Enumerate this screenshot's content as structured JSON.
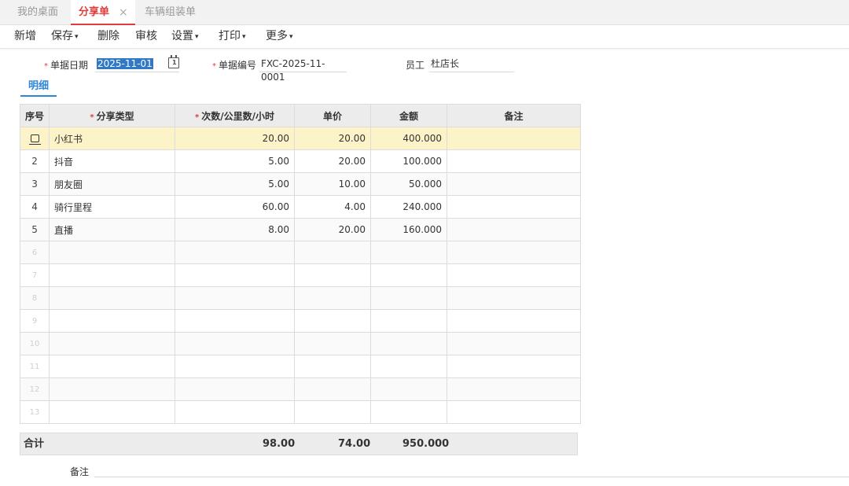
{
  "tabs": [
    {
      "label": "我的桌面",
      "active": false
    },
    {
      "label": "分享单",
      "active": true,
      "close": "×"
    },
    {
      "label": "车辆组装单",
      "active": false
    }
  ],
  "toolbar": [
    {
      "label": "新增",
      "caret": ""
    },
    {
      "label": "保存",
      "caret": "▾"
    },
    {
      "label": "删除",
      "caret": ""
    },
    {
      "label": "审核",
      "caret": ""
    },
    {
      "label": "设置",
      "caret": "▾"
    },
    {
      "label": "打印",
      "caret": "▾"
    },
    {
      "label": "更多",
      "caret": "▾"
    }
  ],
  "form": {
    "date_label": "单据日期",
    "date_value": "2025-11-01",
    "no_label": "单据编号",
    "no_value": "FXC-2025-11-0001",
    "employee_label": "员工",
    "employee_value": "杜店长",
    "required_mark": "*"
  },
  "detail_tab": "明细",
  "grid": {
    "headers": [
      "序号",
      "分享类型",
      "次数/公里数/小时",
      "单价",
      "金额",
      "备注"
    ],
    "rows": [
      {
        "idx": "",
        "type": "小红书",
        "qty": "20.00",
        "price": "20.00",
        "amount": "400.000",
        "note": ""
      },
      {
        "idx": "2",
        "type": "抖音",
        "qty": "5.00",
        "price": "20.00",
        "amount": "100.000",
        "note": ""
      },
      {
        "idx": "3",
        "type": "朋友圈",
        "qty": "5.00",
        "price": "10.00",
        "amount": "50.000",
        "note": ""
      },
      {
        "idx": "4",
        "type": "骑行里程",
        "qty": "60.00",
        "price": "4.00",
        "amount": "240.000",
        "note": ""
      },
      {
        "idx": "5",
        "type": "直播",
        "qty": "8.00",
        "price": "20.00",
        "amount": "160.000",
        "note": ""
      }
    ],
    "empty_rows": [
      "6",
      "7",
      "8",
      "9",
      "10",
      "11",
      "12",
      "13"
    ]
  },
  "totals": {
    "label": "合计",
    "qty": "98.00",
    "price": "74.00",
    "amount": "950.000"
  },
  "remark_label": "备注",
  "colors": {
    "active_tab": "#e03c3c",
    "detail_tab": "#2f86d6",
    "selected_row": "#fdf3c8",
    "date_highlight": "#3178c6"
  },
  "icons": {
    "row_editor": "row-edit-icon",
    "calendar": "calendar-icon",
    "close": "close-icon"
  }
}
